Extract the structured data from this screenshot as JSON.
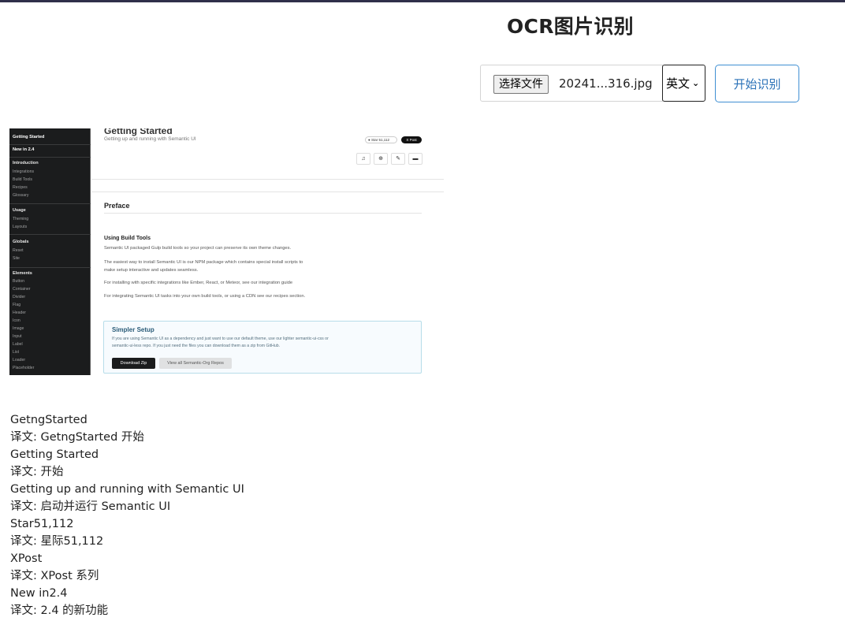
{
  "header": {
    "title": "OCR图片识别"
  },
  "controls": {
    "file_button_label": "选择文件",
    "file_name": "20241...316.jpg",
    "language_selected": "英文",
    "start_button_label": "开始识别"
  },
  "preview": {
    "sidebar": [
      {
        "label": "Getting Started",
        "kind": "strong"
      },
      {
        "label": "New in 2.4",
        "kind": "strong"
      },
      {
        "label": "Introduction",
        "kind": "head"
      },
      {
        "label": "Integrations",
        "kind": "item"
      },
      {
        "label": "Build Tools",
        "kind": "item"
      },
      {
        "label": "Recipes",
        "kind": "item"
      },
      {
        "label": "Glossary",
        "kind": "item"
      },
      {
        "label": "Usage",
        "kind": "head"
      },
      {
        "label": "Theming",
        "kind": "item"
      },
      {
        "label": "Layouts",
        "kind": "item"
      },
      {
        "label": "Globals",
        "kind": "head"
      },
      {
        "label": "Reset",
        "kind": "item"
      },
      {
        "label": "Site",
        "kind": "item"
      },
      {
        "label": "Elements",
        "kind": "head"
      },
      {
        "label": "Button",
        "kind": "item"
      },
      {
        "label": "Container",
        "kind": "item"
      },
      {
        "label": "Divider",
        "kind": "item"
      },
      {
        "label": "Flag",
        "kind": "item"
      },
      {
        "label": "Header",
        "kind": "item"
      },
      {
        "label": "Icon",
        "kind": "item"
      },
      {
        "label": "Image",
        "kind": "item"
      },
      {
        "label": "Input",
        "kind": "item"
      },
      {
        "label": "Label",
        "kind": "item"
      },
      {
        "label": "List",
        "kind": "item"
      },
      {
        "label": "Loader",
        "kind": "item"
      },
      {
        "label": "Placeholder",
        "kind": "item"
      }
    ],
    "title": "Getting Started",
    "subtitle": "Getting up and running with Semantic UI",
    "star_label": "Star",
    "star_count": "51,112",
    "post_label": "X Post",
    "icons": [
      "music-icon",
      "globe-icon",
      "edit-icon",
      "window-icon"
    ],
    "section_title": "Preface",
    "subsection_title": "Using Build Tools",
    "paragraphs": [
      "Semantic UI packaged Gulp build tools so your project can preserve its own theme changes.",
      "The easiest way to install Semantic UI is our NPM package which contains special install scripts to",
      "make setup interactive and updates seamless.",
      "For installing with specific integrations like Ember, React, or Meteor, see our integration guide",
      "For integrating Semantic UI tasks into your own build tools, or using a CDN see our recipes section."
    ],
    "setup": {
      "title": "Simpler Setup",
      "lines": [
        "If you are using Semantic UI as a dependency and just want to use our default theme, use our lighter  semantic-ui-css  or",
        "semantic-ui-less  repo. If you just need the files you can download them as a zip from GitHub."
      ],
      "download_label": "Download Zip",
      "repos_label": "View all Semantic-Org Repos"
    }
  },
  "results": [
    "GetngStarted",
    "译文: GetngStarted 开始",
    "Getting Started",
    "译文: 开始",
    "Getting up and running with Semantic UI",
    "译文: 启动并运行 Semantic UI",
    "Star51,112",
    "译文: 星际51,112",
    "XPost",
    "译文: XPost 系列",
    "New in2.4",
    "译文: 2.4 的新功能"
  ]
}
